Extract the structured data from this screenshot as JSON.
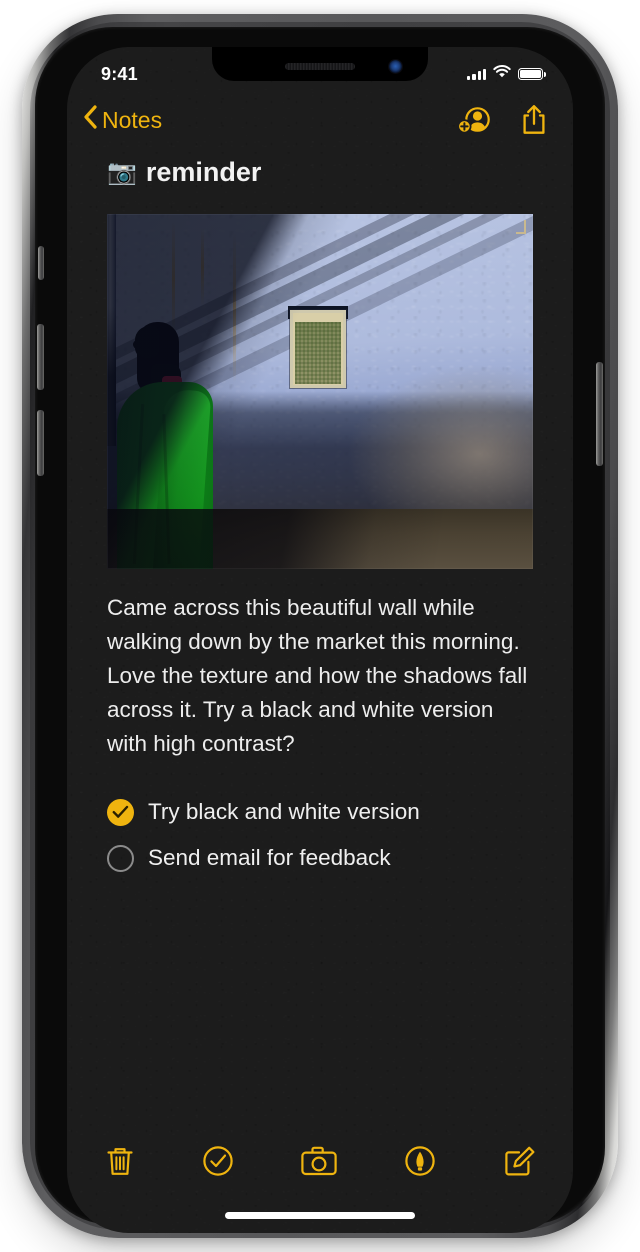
{
  "device": {
    "name": "iphone-x-space-gray",
    "buttons": [
      "silent-switch",
      "volume-up-button",
      "volume-down-button",
      "power-button"
    ]
  },
  "statusbar": {
    "time": "9:41",
    "cellular_icon": "signal-bars-icon",
    "cellular_bars": 4,
    "wifi_icon": "wifi-icon",
    "battery_icon": "battery-icon",
    "battery_level": 100
  },
  "navbar": {
    "back_label": "Notes",
    "back_icon": "chevron-left-icon",
    "actions": [
      {
        "name": "add-people-button",
        "icon": "add-person-icon"
      },
      {
        "name": "share-button",
        "icon": "share-icon"
      }
    ]
  },
  "note": {
    "emoji": "📷",
    "emoji_name": "camera-emoji",
    "title": "reminder",
    "photo": {
      "alt": "Woman in a green sari walking past a blue painted wall with diagonal shadows and a shuttered window"
    },
    "body": "Came across this beautiful wall while walking down by the market this morning. Love the texture and how the shadows fall across it. Try a black and white version with high contrast?",
    "checklist": [
      {
        "label": "Try black and white version",
        "checked": true
      },
      {
        "label": "Send email for feedback",
        "checked": false
      }
    ]
  },
  "toolbar": {
    "items": [
      {
        "name": "delete-button",
        "icon": "trash-icon"
      },
      {
        "name": "checklist-button",
        "icon": "check-circle-icon"
      },
      {
        "name": "camera-button",
        "icon": "camera-icon"
      },
      {
        "name": "markup-button",
        "icon": "markup-pen-icon"
      },
      {
        "name": "compose-button",
        "icon": "compose-icon"
      }
    ]
  },
  "colors": {
    "accent": "#EFB40F",
    "background": "#1C1C1C",
    "text_primary": "#EFEFEF",
    "checkbox_empty_stroke": "#8B8B8B",
    "status_text": "#FFFFFF"
  }
}
